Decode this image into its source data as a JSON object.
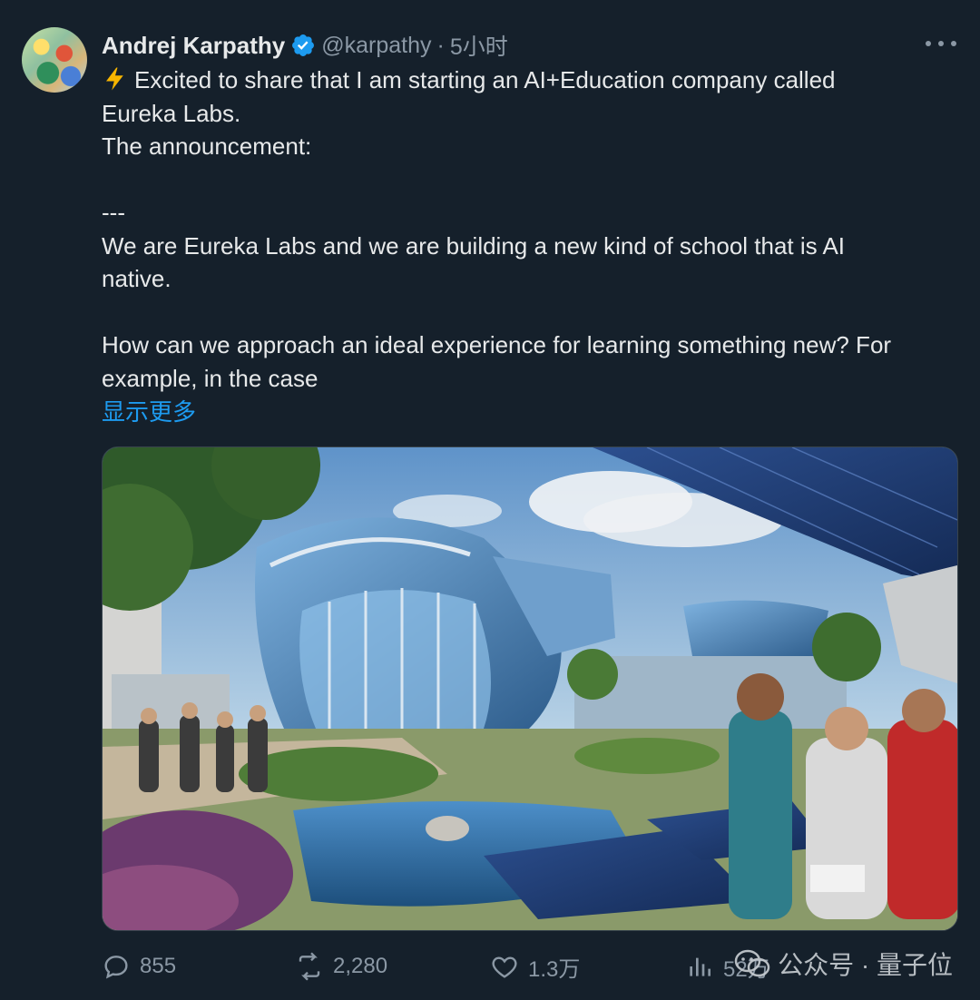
{
  "tweet": {
    "author_name": "Andrej Karpathy",
    "handle": "@karpathy",
    "separator": "·",
    "time": "5小时",
    "lines": [
      "Excited to share that I am starting an AI+Education company called",
      "Eureka Labs.",
      "The announcement:",
      "",
      "---",
      "We are Eureka Labs and we are building a new kind of school that is AI",
      "native.",
      "",
      "How can we approach an ideal experience for learning something new? For",
      "example, in the case"
    ],
    "show_more": "显示更多"
  },
  "actions": {
    "replies": "855",
    "retweets": "2,280",
    "likes": "1.3万",
    "views": "52万"
  },
  "watermark": {
    "text": "公众号 · 量子位"
  },
  "icons": [
    "verified-badge-icon",
    "more-options-icon",
    "lightning-icon",
    "reply-icon",
    "retweet-icon",
    "like-icon",
    "views-icon",
    "wechat-icon"
  ],
  "colors": {
    "background": "#15202b",
    "text": "#e7e9ea",
    "secondary": "#8b98a5",
    "link": "#1d9bf0"
  }
}
